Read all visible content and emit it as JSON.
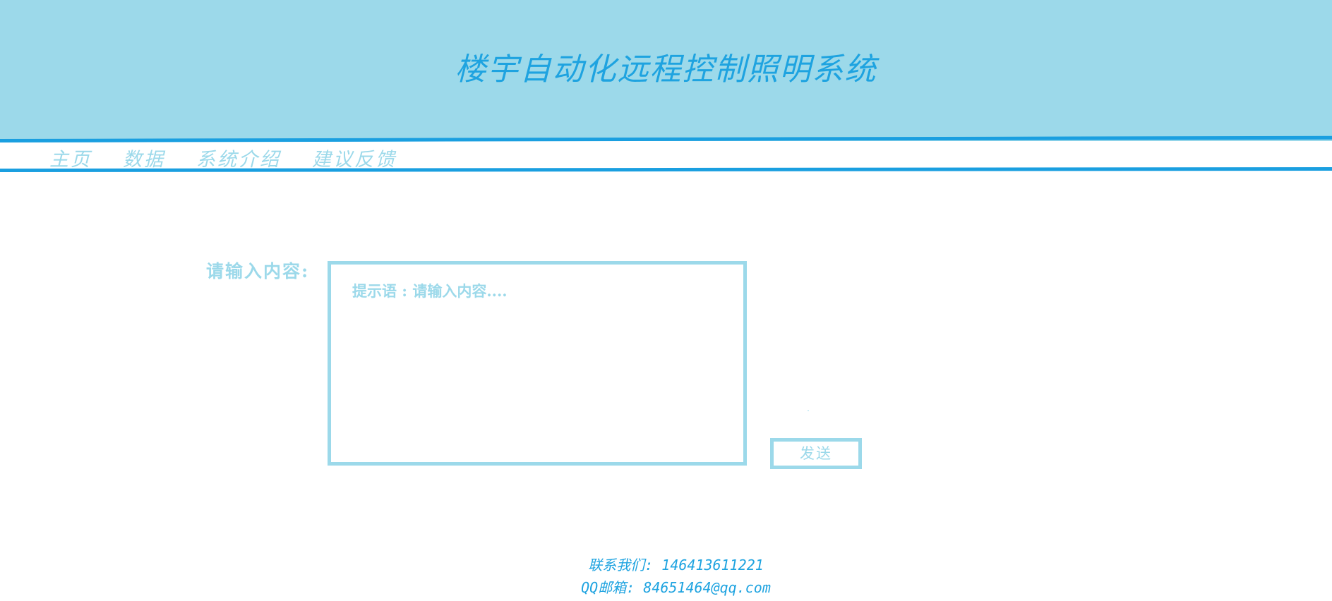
{
  "header": {
    "title": "楼宇自动化远程控制照明系统"
  },
  "nav": {
    "items": [
      {
        "label": "主页"
      },
      {
        "label": "数据"
      },
      {
        "label": "系统介绍"
      },
      {
        "label": "建议反馈"
      }
    ]
  },
  "form": {
    "label": "请输入内容:",
    "placeholder": "提示语 : 请输入内容....",
    "value": "",
    "send_label": "发送"
  },
  "footer": {
    "contact": "联系我们: 146413611221",
    "email": "QQ邮箱: 84651464@qq.com"
  },
  "colors": {
    "header_bg": "#9cd9ea",
    "accent": "#1a9fe0",
    "light_text": "#9cd9ea"
  }
}
